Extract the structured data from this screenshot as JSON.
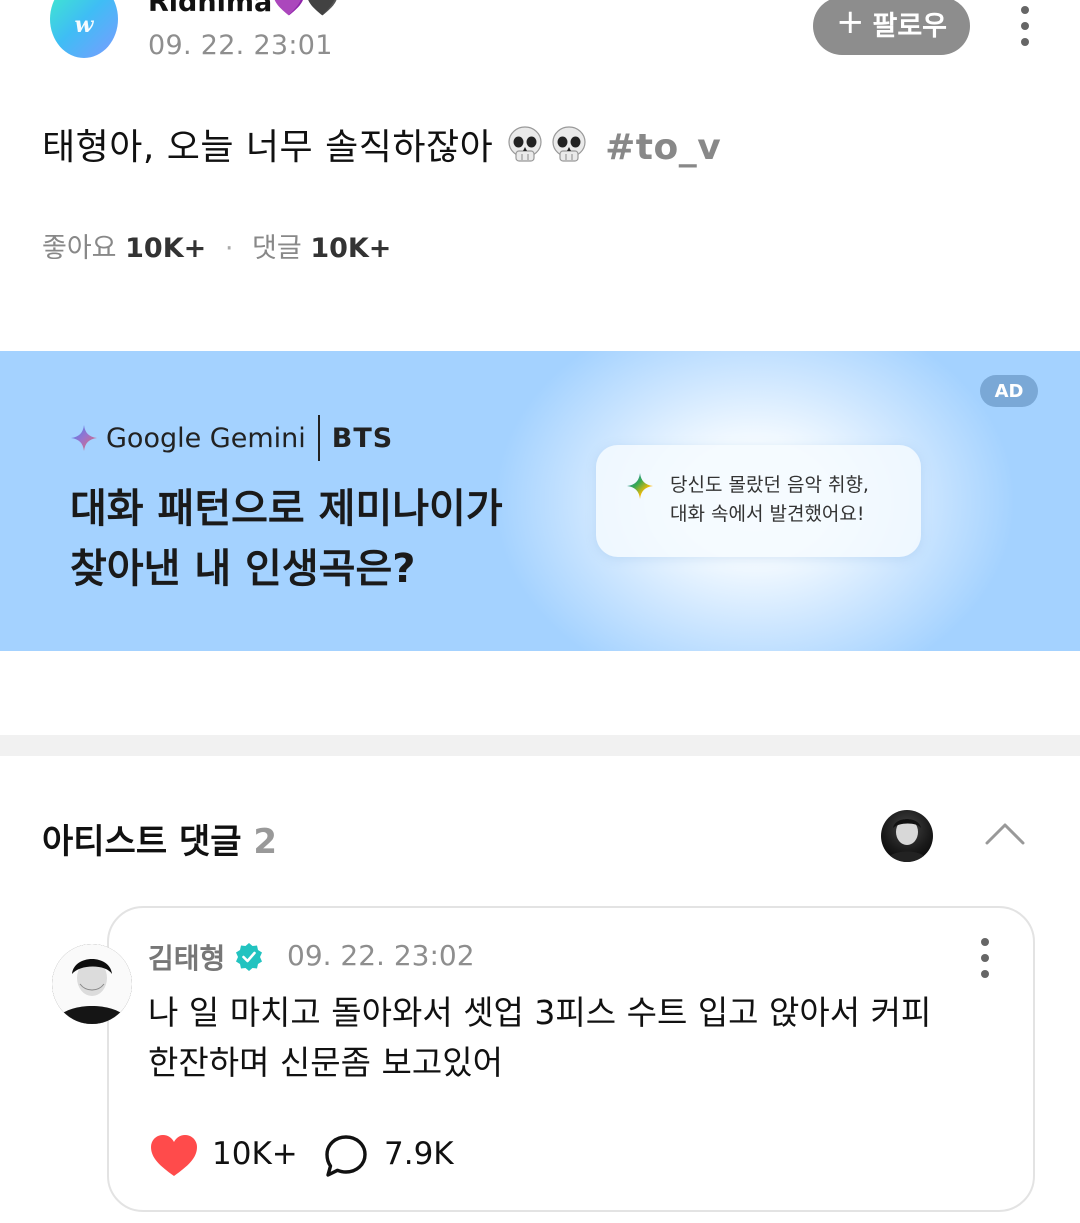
{
  "post": {
    "avatar_letter": "w",
    "username": "Ridnima",
    "username_emojis": [
      "💜",
      "🖤"
    ],
    "timestamp": "09. 22. 23:01",
    "follow_label": "팔로우",
    "text": "태형아, 오늘 너무 솔직하잖아",
    "emoji_icons": [
      "skull-icon",
      "skull-icon"
    ],
    "hashtag": "#to_v",
    "likes_label": "좋아요",
    "likes_count": "10K+",
    "comments_label": "댓글",
    "comments_count": "10K+"
  },
  "ad": {
    "badge": "AD",
    "brand": "Google Gemini",
    "partner": "BTS",
    "headline_line1": "대화 패턴으로 제미나이가",
    "headline_line2": "찾아낸 내 인생곡은?",
    "bubble_line1": "당신도 몰랐던 음악 취향,",
    "bubble_line2": "대화 속에서 발견했어요!",
    "colors": {
      "background": "#a4d2ff",
      "badge": "#7aa8d6"
    }
  },
  "artist_comments": {
    "title": "아티스트 댓글",
    "count": "2",
    "comment": {
      "author": "김태형",
      "timestamp": "09. 22. 23:02",
      "line1": "나 일 마치고 돌아와서 셋업 3피스 수트 입고 앉아서 커피",
      "line2": "한잔하며 신문좀 보고있어",
      "likes": "10K+",
      "replies": "7.9K"
    }
  },
  "colors": {
    "follow_button": "#8d8d8d",
    "verified_badge": "#22c3c0",
    "heart": "#ff4b4b",
    "muted_text": "#8e8e8e"
  }
}
